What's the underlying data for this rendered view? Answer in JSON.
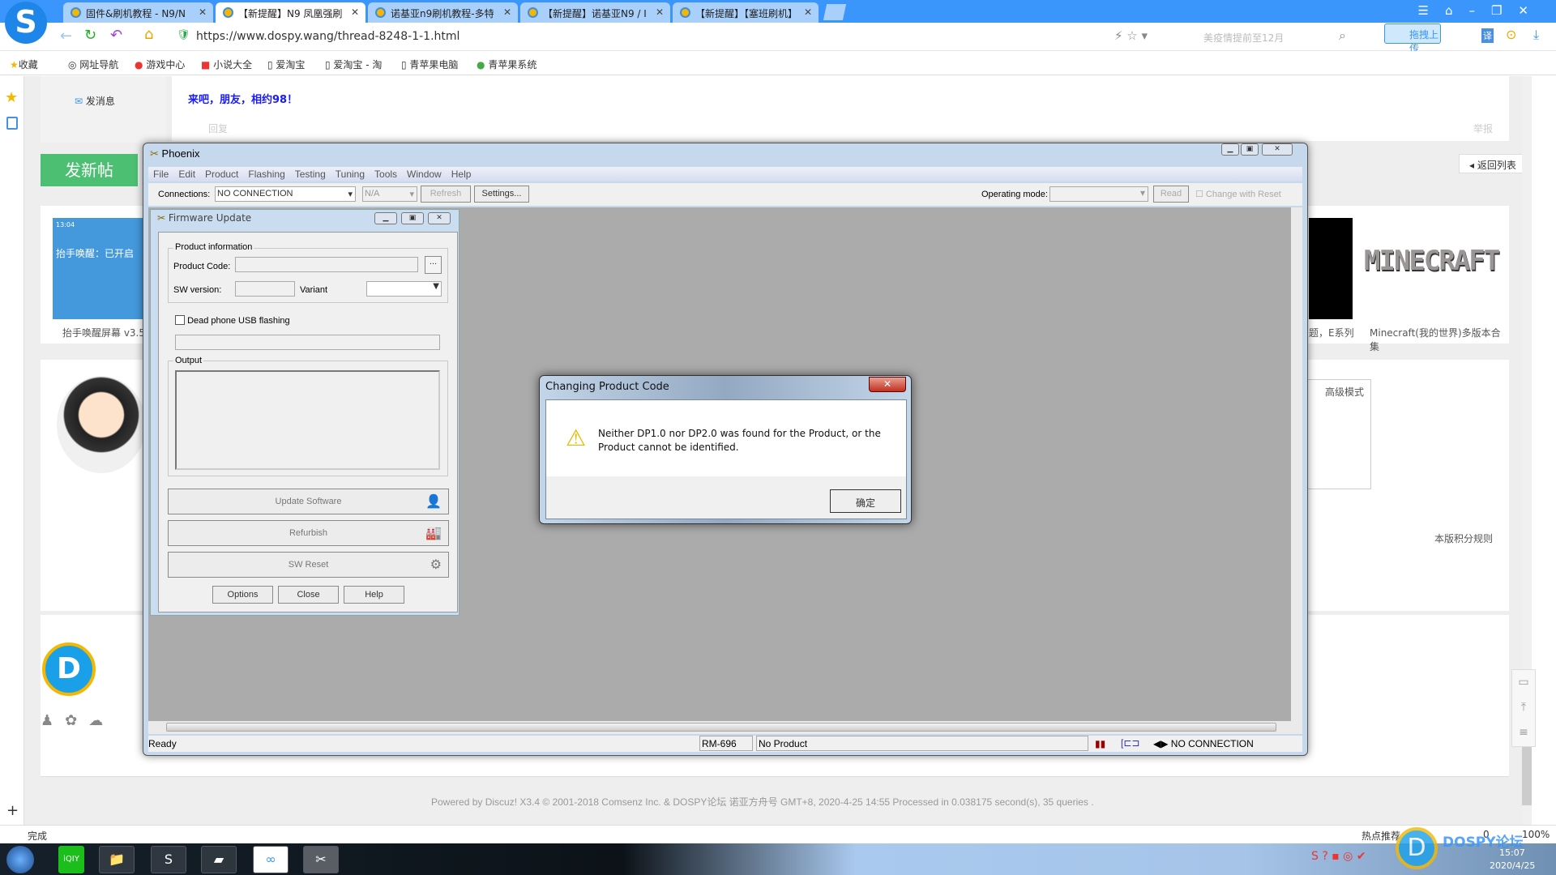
{
  "browser": {
    "tabs": [
      {
        "label": "固件&刷机教程 - N9/N"
      },
      {
        "label": "【新提醒】N9 凤凰强刷"
      },
      {
        "label": "诺基亚n9刷机教程-多特"
      },
      {
        "label": "【新提醒】诺基亚N9 / I"
      },
      {
        "label": "【新提醒】【塞班刷机】"
      }
    ],
    "active_tab": 1,
    "url": "https://www.dospy.wang/thread-8248-1-1.html",
    "search_placeholder": "美疫情提前至12月",
    "upload_label": "拖拽上传",
    "translate_label": "译",
    "bookmarks": [
      "收藏",
      "网址导航",
      "游戏中心",
      "小说大全",
      "爱淘宝",
      "爱淘宝 - 淘",
      "青苹果电脑",
      "青苹果系统"
    ],
    "status": "完成",
    "status_right": [
      "热点推荐",
      "0",
      "100%"
    ],
    "accent": "#3a96fa"
  },
  "forum": {
    "send_message": "发消息",
    "post_text": "来吧，朋友，相约98！",
    "reply": "回复",
    "report": "举报",
    "new_post": "发新帖",
    "back_to_list": "返回列表",
    "thumb1_caption": "抬手唤醒屏幕 v3.5",
    "thumb1_title": "抬手唤醒：已开启",
    "thumb1_time": "13:04",
    "thumb2_caption": "题，E系列",
    "thumb3_caption": "Minecraft(我的世界)多版本合集",
    "minecraft_logo": "MINECRAFT",
    "advanced_mode": "高级模式",
    "points_rules": "本版积分规则",
    "footer": "Powered by Discuz! X3.4 © 2001-2018 Comsenz Inc. & DOSPY论坛 诺亚方舟号 GMT+8, 2020-4-25 14:55 Processed in 0.038175 second(s), 35 queries ."
  },
  "phoenix": {
    "title": "Phoenix",
    "menu": [
      "File",
      "Edit",
      "Product",
      "Flashing",
      "Testing",
      "Tuning",
      "Tools",
      "Window",
      "Help"
    ],
    "connections_label": "Connections:",
    "connection_value": "NO CONNECTION",
    "na_value": "N/A",
    "refresh": "Refresh",
    "settings": "Settings...",
    "operating_mode_label": "Operating mode:",
    "read": "Read",
    "change_with_reset": "Change with Reset",
    "status": {
      "ready": "Ready",
      "model": "RM-696",
      "product": "No Product",
      "connection": "NO CONNECTION"
    }
  },
  "firmware": {
    "title": "Firmware Update",
    "product_info": "Product information",
    "product_code_label": "Product Code:",
    "product_code_value": "",
    "browse": "...",
    "sw_version_label": "SW version:",
    "variant_label": "Variant",
    "dead_phone": "Dead phone USB flashing",
    "dead_phone_checked": false,
    "output_label": "Output",
    "update_software": "Update Software",
    "refurbish": "Refurbish",
    "sw_reset": "SW Reset",
    "options": "Options",
    "close": "Close",
    "help": "Help"
  },
  "dialog": {
    "title": "Changing Product Code",
    "message": "Neither DP1.0 nor DP2.0 was found for the Product, or the Product cannot be identified.",
    "ok": "确定",
    "icon": "warning-icon"
  },
  "taskbar": {
    "clock_time": "15:07",
    "clock_date": "2020/4/25",
    "watermark": "DOSPY论坛"
  }
}
